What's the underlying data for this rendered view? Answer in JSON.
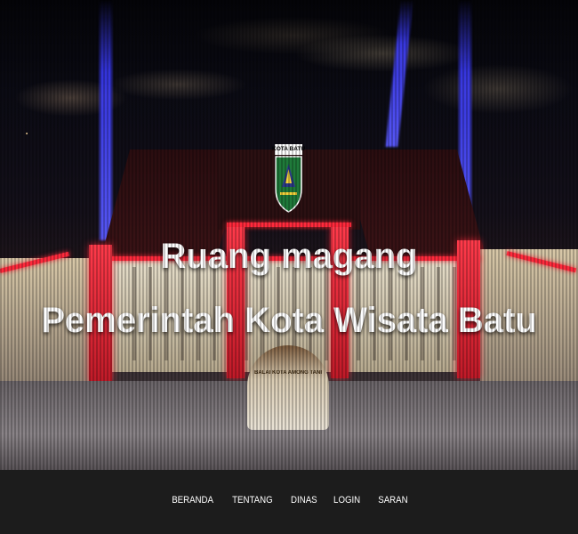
{
  "hero": {
    "title_line1": "Ruang magang",
    "title_line2": "Pemerintah Kota Wisata Batu",
    "logo_text": "KOTA BATU",
    "building_sign": "BALAI KOTA AMONG TANI"
  },
  "nav": {
    "items": [
      {
        "label": "BERANDA"
      },
      {
        "label": "TENTANG"
      },
      {
        "label": "DINAS"
      },
      {
        "label": "LOGIN"
      },
      {
        "label": "SARAN"
      }
    ]
  },
  "colors": {
    "footer_bg": "#1c1c1c",
    "accent_red": "#ff2a3c",
    "beam_blue": "#4a4aff"
  }
}
